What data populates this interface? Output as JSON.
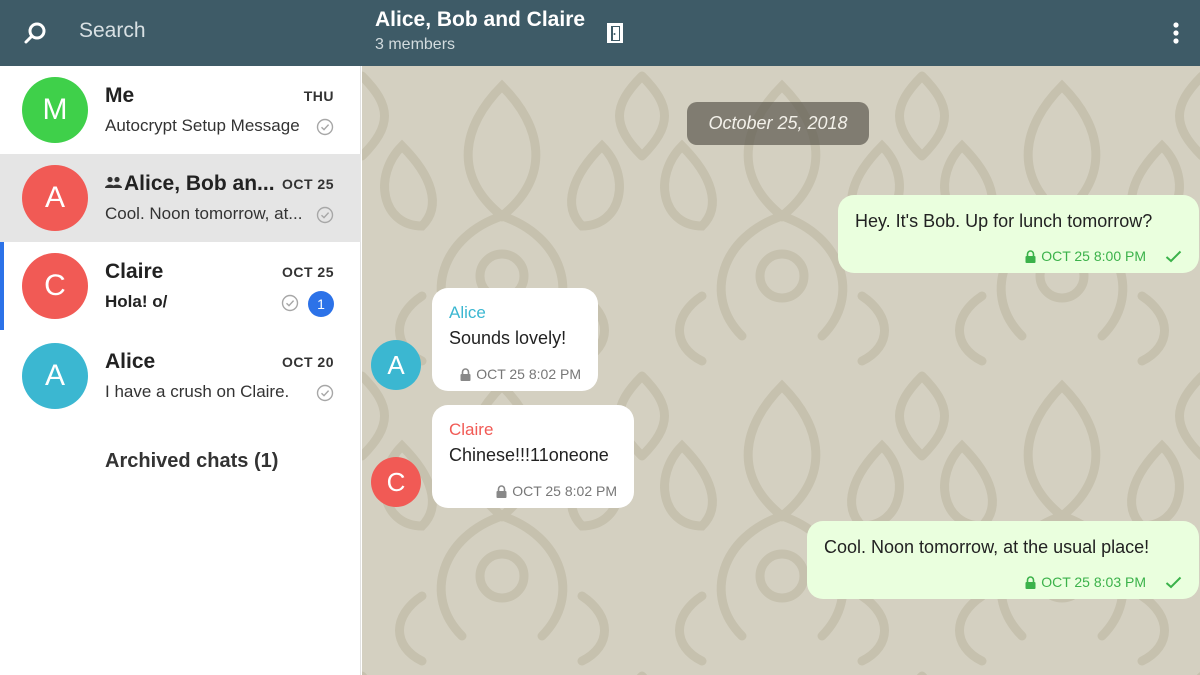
{
  "header": {
    "search_label": "Search",
    "chat_title": "Alice, Bob and Claire",
    "chat_subtitle": "3 members",
    "icons": [
      "search-icon",
      "door-icon",
      "menu-icon"
    ]
  },
  "sidebar": {
    "chats": [
      {
        "initial": "M",
        "name": "Me",
        "date": "THU",
        "preview": "Autocrypt Setup Message",
        "status": "delivered-icon",
        "avatar_color": "#3fd04a"
      },
      {
        "initial": "A",
        "name": "Alice, Bob an...",
        "date": "OCT 25",
        "preview": "Cool. Noon tomorrow, at...",
        "status": "delivered-icon",
        "avatar_color": "#f15a55",
        "is_group": true,
        "selected": true
      },
      {
        "initial": "C",
        "name": "Claire",
        "date": "OCT 25",
        "preview": "Hola! o/",
        "status": "delivered-icon",
        "avatar_color": "#f15a55",
        "unread_count": "1"
      },
      {
        "initial": "A",
        "name": "Alice",
        "date": "OCT 20",
        "preview": "I have a crush on Claire.",
        "status": "delivered-icon",
        "avatar_color": "#3bb7d1"
      }
    ],
    "archived_label": "Archived chats (1)"
  },
  "conversation": {
    "date_separator": "October 25, 2018",
    "messages": [
      {
        "direction": "outgoing",
        "text": "Hey. It's Bob. Up for lunch tomorrow?",
        "time": "OCT 25 8:00 PM"
      },
      {
        "direction": "incoming",
        "sender": "Alice",
        "sender_initial": "A",
        "sender_color": "#3bb7d1",
        "text": "Sounds lovely!",
        "time": "OCT 25 8:02 PM"
      },
      {
        "direction": "incoming",
        "sender": "Claire",
        "sender_initial": "C",
        "sender_color": "#f15a55",
        "text": "Chinese!!!11oneone",
        "time": "OCT 25 8:02 PM"
      },
      {
        "direction": "outgoing",
        "text": "Cool. Noon tomorrow, at the usual place!",
        "time": "OCT 25 8:03 PM"
      }
    ]
  },
  "colors": {
    "header_bg": "#3e5b67",
    "outgoing_bubble": "#eaffde",
    "incoming_bubble": "#ffffff",
    "accent_green": "#3bb24a",
    "unread_blue": "#2c72e8"
  }
}
